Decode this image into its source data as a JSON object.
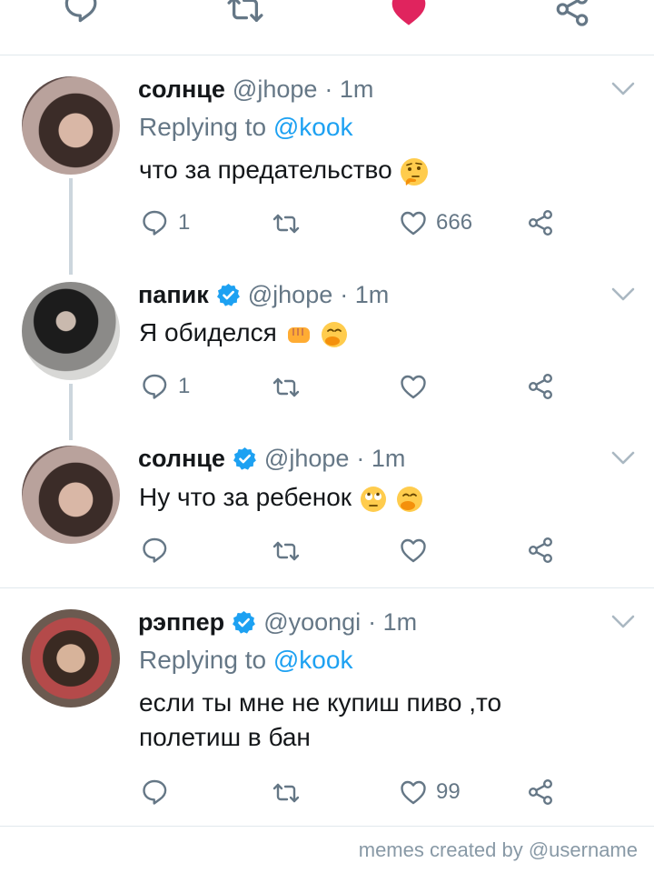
{
  "top_actions": {
    "like_color": "#e0245e"
  },
  "tweets": [
    {
      "name": "солнце",
      "handle": "@jhope",
      "time": "· 1m",
      "verified": false,
      "replying_label": "Replying to",
      "replying_to": "@kook",
      "text": "что за предательство",
      "emojis": [
        "thinking-face"
      ],
      "reply_count": "1",
      "like_count": "666"
    },
    {
      "name": "папик",
      "handle": "@jhope",
      "time": "· 1m",
      "verified": true,
      "text": "Я обиделся",
      "emojis": [
        "oncoming-fist",
        "face-with-hand-over-mouth"
      ],
      "reply_count": "1",
      "like_count": ""
    },
    {
      "name": "солнце",
      "handle": "@jhope",
      "time": "· 1m",
      "verified": true,
      "text": "Ну что за ребенок",
      "emojis": [
        "face-with-rolling-eyes",
        "face-with-hand-over-mouth"
      ],
      "reply_count": "",
      "like_count": ""
    },
    {
      "name": "рэппер",
      "handle": "@yoongi",
      "time": "· 1m",
      "verified": true,
      "replying_label": "Replying to",
      "replying_to": "@kook",
      "text_line1": "если ты мне не купиш пиво ,то",
      "text_line2": "полетиш в бан",
      "reply_count": "",
      "like_count": "99"
    }
  ],
  "footer": "memes created by @username",
  "colors": {
    "accent": "#1da1f2",
    "muted": "#657786",
    "verified": "#1da1f2",
    "like": "#e0245e"
  }
}
